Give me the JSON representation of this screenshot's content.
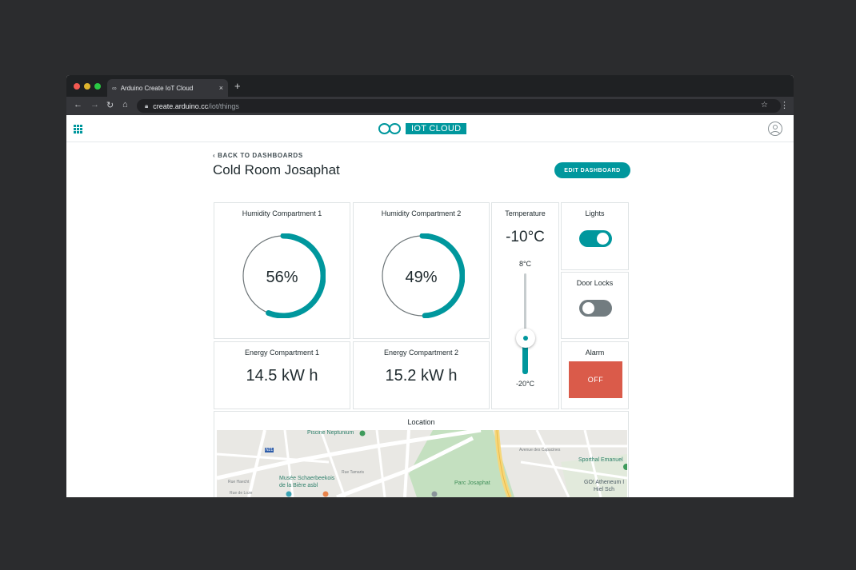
{
  "browser": {
    "tab_title": "Arduino Create IoT Cloud",
    "tab_close": "×",
    "new_tab": "+",
    "url_host": "create.arduino.cc",
    "url_path": "/iot/things"
  },
  "header": {
    "brand": "IOT CLOUD"
  },
  "page": {
    "back_label": "BACK TO DASHBOARDS",
    "title": "Cold Room Josaphat",
    "edit_label": "EDIT DASHBOARD"
  },
  "widgets": {
    "humidity1": {
      "label": "Humidity Compartment 1",
      "value": "56%",
      "fraction": 0.56
    },
    "humidity2": {
      "label": "Humidity Compartment 2",
      "value": "49%",
      "fraction": 0.49
    },
    "energy1": {
      "label": "Energy Compartment 1",
      "value": "14.5 kW h"
    },
    "energy2": {
      "label": "Energy Compartment 2",
      "value": "15.2 kW h"
    },
    "temperature": {
      "label": "Temperature",
      "value": "-10°C",
      "max_label": "8°C",
      "min_label": "-20°C",
      "max": 8,
      "min": -20,
      "current": -10
    },
    "lights": {
      "label": "Lights",
      "on": true
    },
    "door_locks": {
      "label": "Door Locks",
      "on": false
    },
    "alarm": {
      "label": "Alarm",
      "button": "OFF"
    },
    "location": {
      "label": "Location"
    }
  },
  "map": {
    "labels": {
      "piscine": "Piscine Neptunium",
      "capucines": "Avenue des Capucines",
      "sporthal": "Sporthal Emanuel",
      "musee1": "Musée Schaerbeekois",
      "musee2": "de la Bière asbl",
      "parc": "Parc Josaphat",
      "atheneum1": "GO! Atheneum I",
      "atheneum2": "Hiel Sch",
      "rue_tamaris": "Rue Tamaris",
      "rue_haecht": "Rue Haecht",
      "rue_loze": "Rue de Loze",
      "route_n21": "N21"
    }
  },
  "colors": {
    "accent": "#00979d",
    "alarm_off": "#da5b4a",
    "switch_off": "#727c80"
  }
}
